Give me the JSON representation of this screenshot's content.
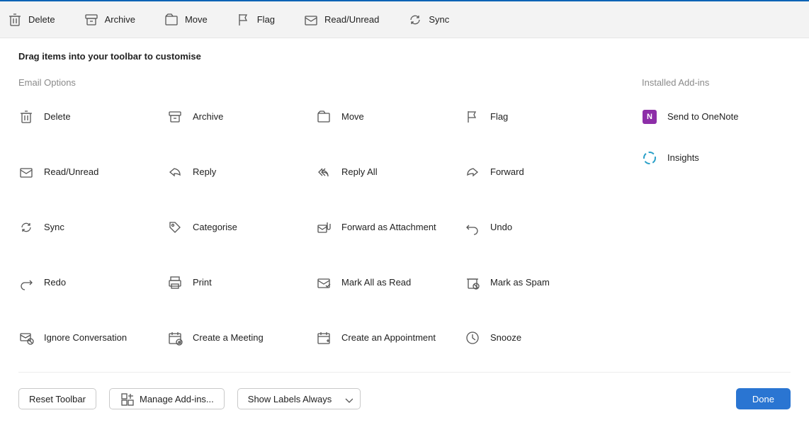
{
  "toolbar": {
    "items": [
      {
        "id": "delete",
        "label": "Delete"
      },
      {
        "id": "archive",
        "label": "Archive"
      },
      {
        "id": "move",
        "label": "Move"
      },
      {
        "id": "flag",
        "label": "Flag"
      },
      {
        "id": "readunread",
        "label": "Read/Unread"
      },
      {
        "id": "sync",
        "label": "Sync"
      }
    ]
  },
  "hint": "Drag items into your toolbar to customise",
  "sections": {
    "email_options_title": "Email Options",
    "addins_title": "Installed Add-ins"
  },
  "options": [
    {
      "id": "delete",
      "label": "Delete"
    },
    {
      "id": "archive",
      "label": "Archive"
    },
    {
      "id": "move",
      "label": "Move"
    },
    {
      "id": "flag",
      "label": "Flag"
    },
    {
      "id": "readunread",
      "label": "Read/Unread"
    },
    {
      "id": "reply",
      "label": "Reply"
    },
    {
      "id": "replyall",
      "label": "Reply All"
    },
    {
      "id": "forward",
      "label": "Forward"
    },
    {
      "id": "sync",
      "label": "Sync"
    },
    {
      "id": "categorise",
      "label": "Categorise"
    },
    {
      "id": "fwd-attach",
      "label": "Forward as Attachment"
    },
    {
      "id": "undo",
      "label": "Undo"
    },
    {
      "id": "redo",
      "label": "Redo"
    },
    {
      "id": "print",
      "label": "Print"
    },
    {
      "id": "markallread",
      "label": "Mark All as Read"
    },
    {
      "id": "markspam",
      "label": "Mark as Spam"
    },
    {
      "id": "ignoreconv",
      "label": "Ignore Conversation"
    },
    {
      "id": "createmeeting",
      "label": "Create a Meeting"
    },
    {
      "id": "createappt",
      "label": "Create an Appointment"
    },
    {
      "id": "snooze",
      "label": "Snooze"
    }
  ],
  "addins": [
    {
      "id": "onenote",
      "label": "Send to OneNote"
    },
    {
      "id": "insights",
      "label": "Insights"
    }
  ],
  "footer": {
    "reset": "Reset Toolbar",
    "manage": "Manage Add-ins...",
    "labels_mode": "Show Labels Always",
    "done": "Done"
  },
  "icons": {
    "onenote_glyph": "N"
  }
}
